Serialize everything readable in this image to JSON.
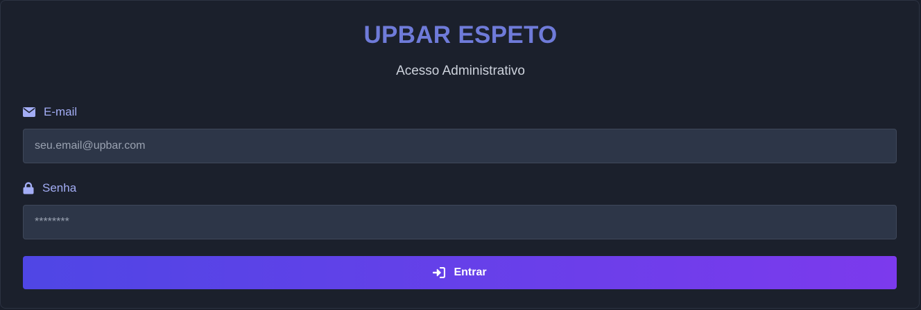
{
  "header": {
    "title": "UPBAR ESPETO",
    "subtitle": "Acesso Administrativo"
  },
  "form": {
    "email": {
      "label": "E-mail",
      "icon": "envelope-icon",
      "placeholder": "seu.email@upbar.com",
      "value": ""
    },
    "password": {
      "label": "Senha",
      "icon": "lock-icon",
      "placeholder": "********",
      "value": ""
    },
    "submit": {
      "label": "Entrar",
      "icon": "sign-in-icon"
    }
  },
  "colors": {
    "background": "#1b202c",
    "title": "#6f7bd9",
    "label": "#a3adf5",
    "input_bg": "#2d3648",
    "button_gradient_start": "#4f46e5",
    "button_gradient_end": "#7c3aed"
  }
}
